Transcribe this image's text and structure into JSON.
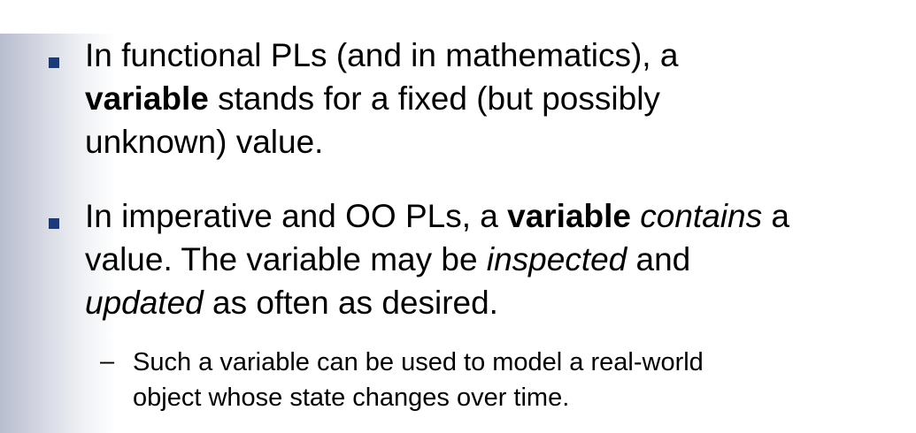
{
  "bullets": [
    {
      "line1": "In functional PLs (and in mathematics), a",
      "line2_bold": "variable",
      "line2_rest": " stands for a fixed (but possibly",
      "line3": "unknown) value."
    },
    {
      "line1_pre": "In imperative and OO PLs, a ",
      "line1_bold": "variable",
      "line1_space": " ",
      "line1_italic": "contains",
      "line1_post": " a",
      "line2_pre": "value. The variable may be ",
      "line2_italic": "inspected",
      "line2_post": " and",
      "line3_italic": "updated",
      "line3_post": " as often as desired."
    }
  ],
  "sub_bullet": {
    "dash": "–",
    "line1": "Such a variable can be used to model a real-world",
    "line2": "object whose state changes over time."
  },
  "colors": {
    "bullet": "#1c3a7a",
    "text": "#000000"
  }
}
